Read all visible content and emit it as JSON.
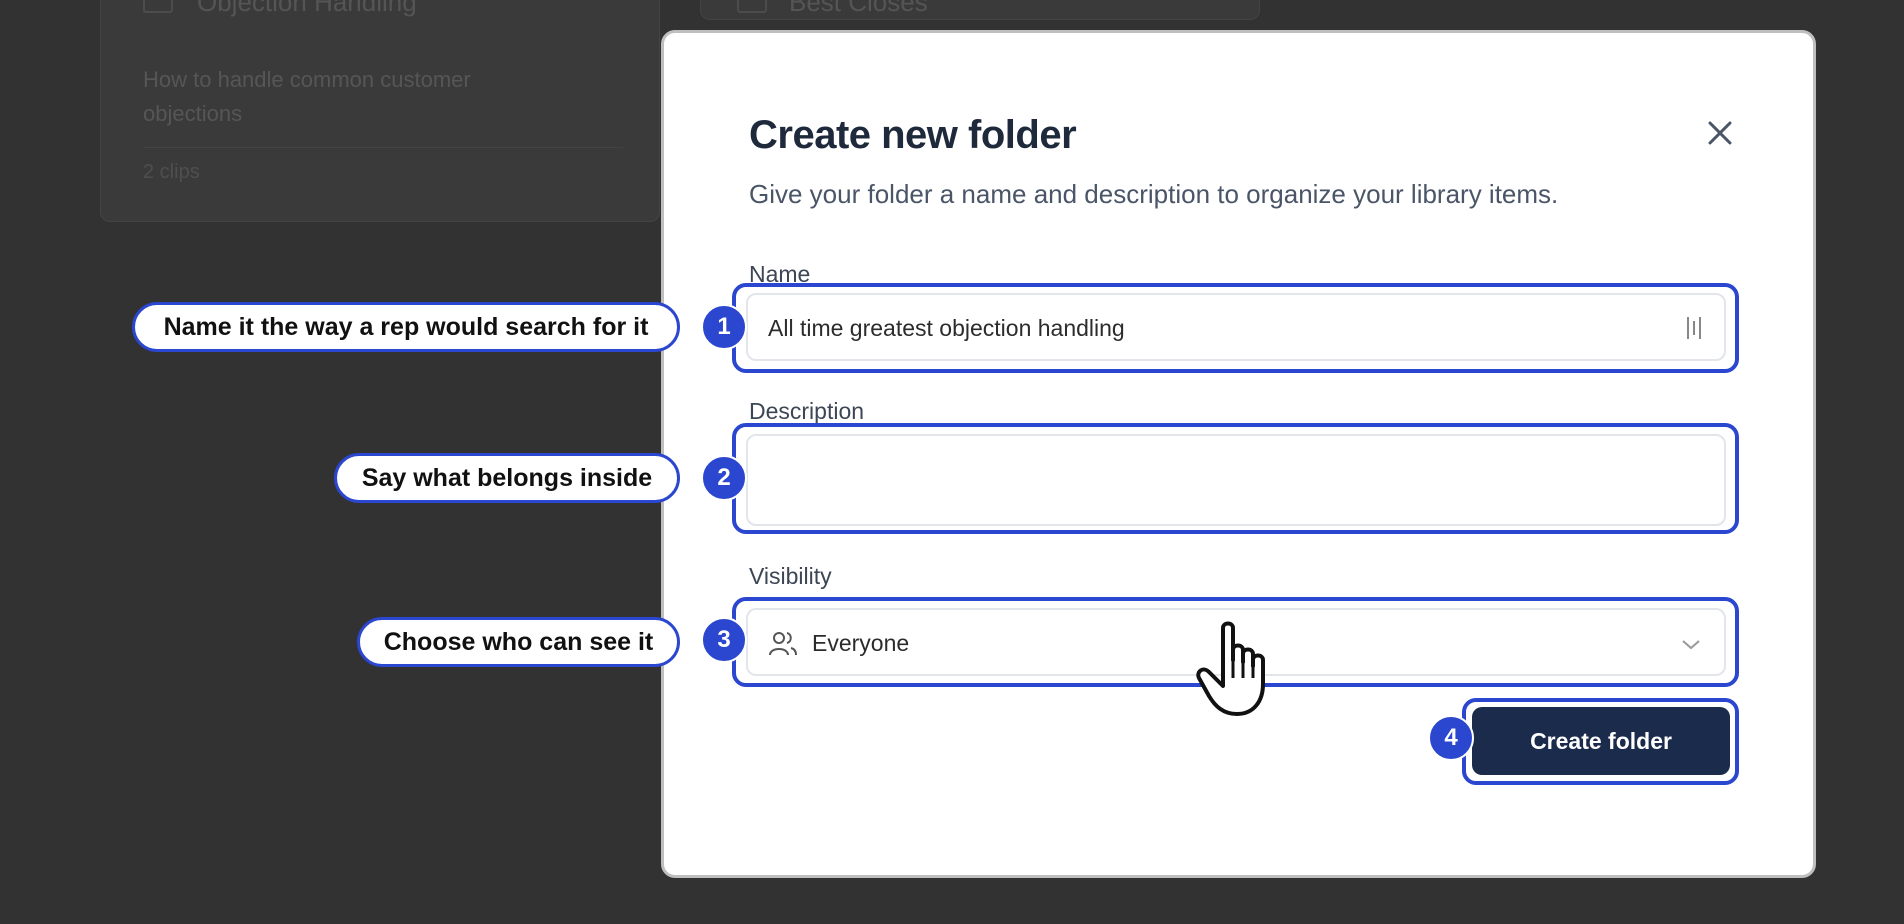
{
  "background": {
    "card1": {
      "title": "Objection Handling",
      "description": "How to handle common customer objections",
      "clips": "2 clips"
    },
    "card2": {
      "title": "Best Closes"
    }
  },
  "modal": {
    "title": "Create new folder",
    "subtitle": "Give your folder a name and description to organize your library items.",
    "close_icon": "close-icon",
    "name_label": "Name",
    "name_value": "All time greatest objection handling",
    "description_label": "Description",
    "description_value": "",
    "visibility_label": "Visibility",
    "visibility_value": "Everyone",
    "submit_label": "Create folder"
  },
  "callouts": [
    {
      "number": "1",
      "text": "Name it the way a rep would search for it"
    },
    {
      "number": "2",
      "text": "Say what belongs inside"
    },
    {
      "number": "3",
      "text": "Choose who can see it"
    },
    {
      "number": "4"
    }
  ],
  "colors": {
    "highlight": "#2b46cf",
    "button": "#1b2b4b",
    "overlay": "#323232"
  }
}
